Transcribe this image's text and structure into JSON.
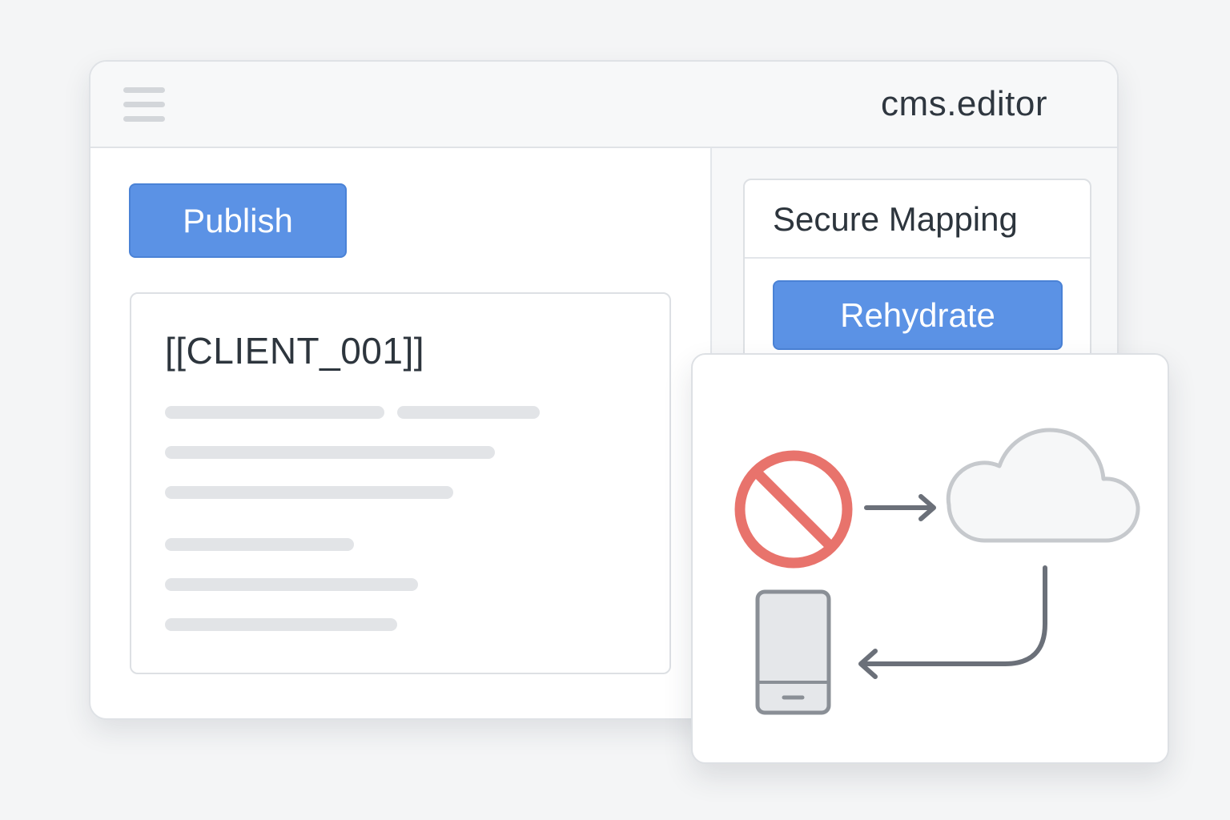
{
  "window": {
    "app_title": "cms.editor",
    "menu_icon": "hamburger-menu-icon"
  },
  "editor": {
    "publish_label": "Publish",
    "document_token": "[[CLIENT_001]]"
  },
  "side_panel": {
    "title": "Secure Mapping",
    "rehydrate_label": "Rehydrate"
  },
  "flow_diagram": {
    "icons": [
      "prohibited-icon",
      "arrow-right-icon",
      "cloud-icon",
      "arrow-return-icon",
      "mobile-phone-icon"
    ]
  },
  "colors": {
    "accent": "#5b92e5",
    "blocked": "#e8736c",
    "icon_gray": "#6b7079"
  }
}
